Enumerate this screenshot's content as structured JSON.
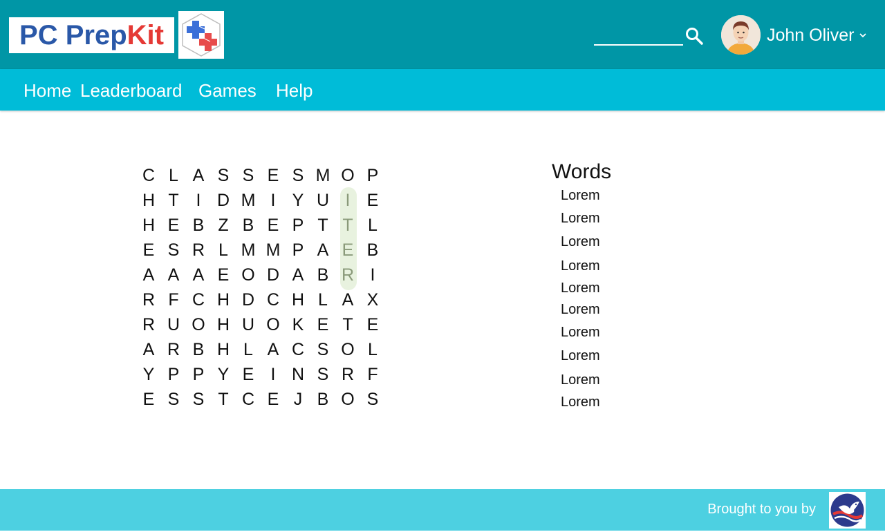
{
  "header": {
    "brand_a": "PC Prep",
    "brand_b": "Kit",
    "search_placeholder": "",
    "user_name": "John Oliver"
  },
  "nav": {
    "items": [
      "Home",
      "Leaderboard",
      "Games",
      "Help"
    ]
  },
  "puzzle": {
    "grid": [
      [
        "C",
        "L",
        "A",
        "S",
        "S",
        "E",
        "S",
        "M",
        "O",
        "P"
      ],
      [
        "H",
        "T",
        "I",
        "D",
        "M",
        "I",
        "Y",
        "U",
        "I",
        "E"
      ],
      [
        "H",
        "E",
        "B",
        "Z",
        "B",
        "E",
        "P",
        "T",
        "T",
        "L"
      ],
      [
        "E",
        "S",
        "R",
        "L",
        "M",
        "M",
        "P",
        "A",
        "E",
        "B"
      ],
      [
        "A",
        "A",
        "A",
        "E",
        "O",
        "D",
        "A",
        "B",
        "R",
        "I"
      ],
      [
        "R",
        "F",
        "C",
        "H",
        "D",
        "C",
        "H",
        "L",
        "A",
        "X"
      ],
      [
        "R",
        "U",
        "O",
        "H",
        "U",
        "O",
        "K",
        "E",
        "T",
        "E"
      ],
      [
        "A",
        "R",
        "B",
        "H",
        "L",
        "A",
        "C",
        "S",
        "O",
        "L"
      ],
      [
        "Y",
        "P",
        "P",
        "Y",
        "E",
        "I",
        "N",
        "S",
        "R",
        "F"
      ],
      [
        "E",
        "S",
        "S",
        "T",
        "C",
        "E",
        "J",
        "B",
        "O",
        "S"
      ]
    ],
    "found_word": "ITER",
    "highlight_color": "#e8f2df"
  },
  "words": {
    "title": "Words",
    "items": [
      "Lorem",
      "Lorem",
      "Lorem",
      "Lorem",
      "Lorem",
      "Lorem",
      "Lorem",
      "Lorem",
      "Lorem",
      "Lorem"
    ]
  },
  "footer": {
    "brought_by": "Brought to you by"
  },
  "colors": {
    "header": "#0096a6",
    "nav": "#00bcd8",
    "footer": "#4dd0e1",
    "brand_blue": "#2a58a8",
    "brand_red": "#e53935"
  }
}
